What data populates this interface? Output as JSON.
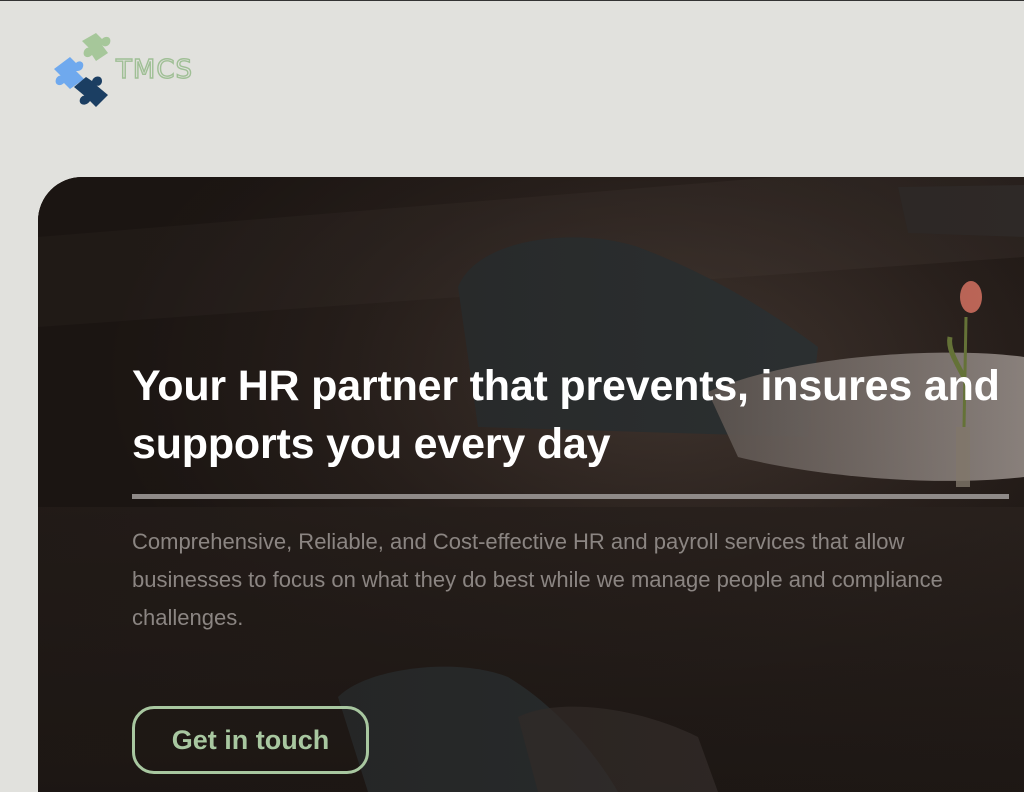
{
  "header": {
    "logo_text": "TMCS",
    "logo_icon": "puzzle-pieces-icon",
    "logo_colors": [
      "#a6c79a",
      "#6fa9ee",
      "#1b3e62"
    ]
  },
  "hero": {
    "headline": "Your HR partner that prevents, insures and supports you every day",
    "subtext": "Comprehensive, Reliable, and Cost-effective HR and payroll services that allow businesses to focus on what they do best while we manage people and compliance challenges.",
    "cta_label": "Get in touch",
    "background_image": "office-chairs-table-tulip-photo"
  },
  "colors": {
    "page_bg": "#e1e1dd",
    "hero_bg": "#1c1613",
    "headline": "#ffffff",
    "subtext": "#8b8582",
    "divider": "#8f8a88",
    "accent": "#a8c7a0"
  }
}
